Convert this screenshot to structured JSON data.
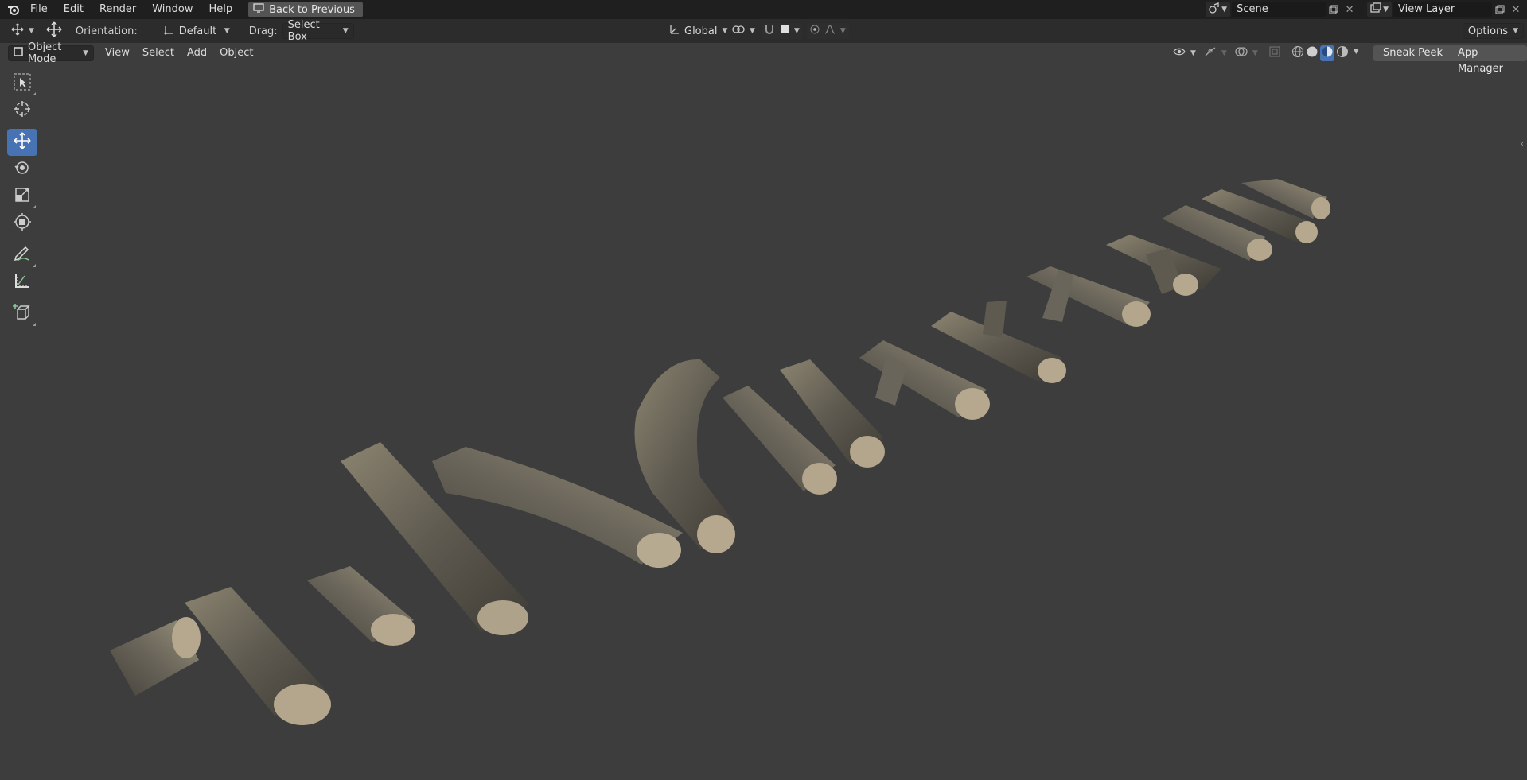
{
  "menubar": {
    "items": [
      "File",
      "Edit",
      "Render",
      "Window",
      "Help"
    ],
    "back_button": "Back to Previous"
  },
  "scene": {
    "name": "Scene"
  },
  "view_layer": {
    "name": "View Layer"
  },
  "tool_header": {
    "orientation_label": "Orientation:",
    "orientation_value": "Default",
    "drag_label": "Drag:",
    "drag_value": "Select Box",
    "transform_orientation": "Global",
    "options_label": "Options"
  },
  "viewport_header": {
    "mode": "Object Mode",
    "menus": [
      "View",
      "Select",
      "Add",
      "Object"
    ],
    "sneak_peek": "Sneak Peek",
    "app_manager": "App Manager"
  },
  "toolbar": {
    "tools": [
      "select-box",
      "cursor",
      "move",
      "rotate",
      "scale",
      "transform",
      "annotate",
      "measure",
      "add-cube"
    ],
    "active_tool": "move"
  },
  "colors": {
    "accent": "#4772b3",
    "viewport_bg": "#3d3d3d",
    "topbar_bg": "#1f1f1f",
    "bark_light": "#b5a88e",
    "bark_dark": "#5a554b"
  }
}
